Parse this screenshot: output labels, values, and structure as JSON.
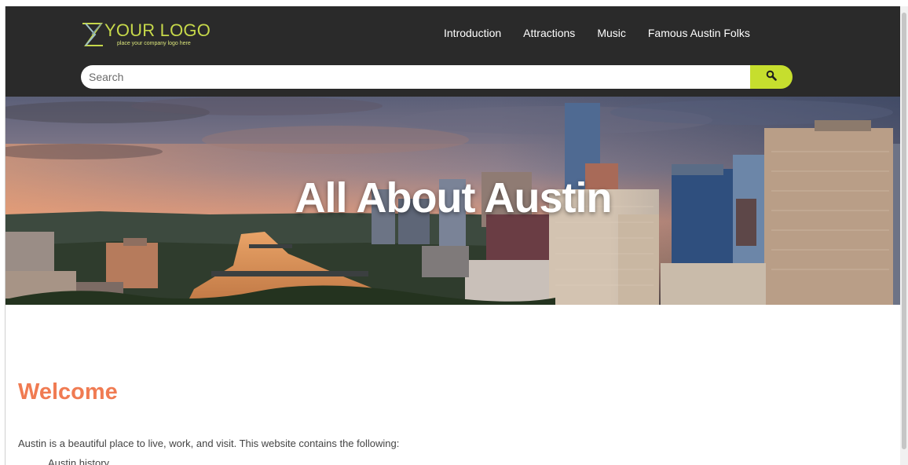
{
  "header": {
    "logo": {
      "text": "YOUR LOGO",
      "tagline": "place your company logo here",
      "icon": "logo-mark-icon"
    },
    "nav": [
      {
        "label": "Introduction"
      },
      {
        "label": "Attractions"
      },
      {
        "label": "Music"
      },
      {
        "label": "Famous Austin Folks"
      }
    ],
    "search": {
      "placeholder": "Search",
      "button_icon": "search-icon"
    }
  },
  "hero": {
    "title": "All About Austin"
  },
  "main": {
    "heading": "Welcome",
    "intro": "Austin is a beautiful place to live, work, and visit. This website contains the following:",
    "list": [
      {
        "label": "Austin history"
      }
    ]
  },
  "colors": {
    "header_bg": "#2a2a2a",
    "accent": "#c6de2e",
    "heading": "#f07b52",
    "text": "#444444"
  }
}
